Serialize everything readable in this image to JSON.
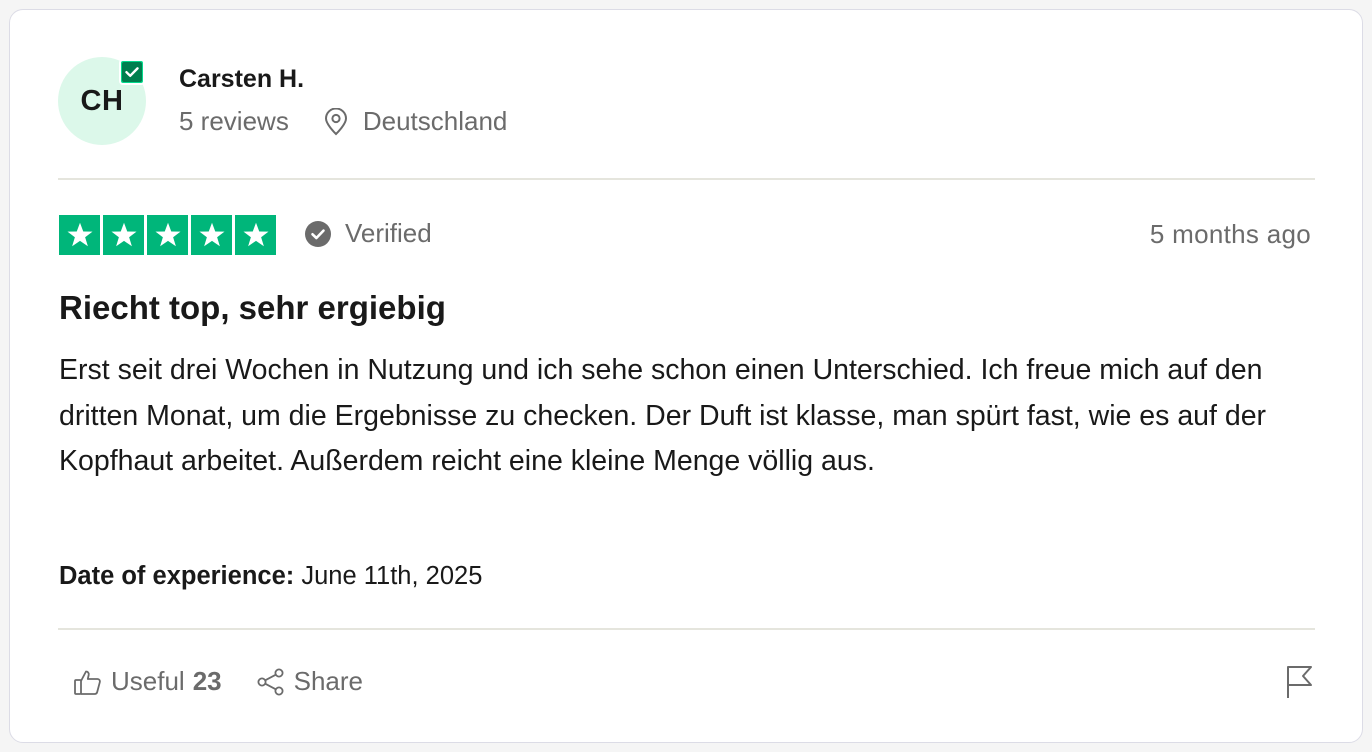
{
  "reviewer": {
    "initials": "CH",
    "name": "Carsten H.",
    "reviews_count": "5 reviews",
    "location": "Deutschland",
    "avatar_bg": "#dcf8ea",
    "badge_icon": "verified-check-badge-icon"
  },
  "review": {
    "rating": 5,
    "rating_max": 5,
    "star_color": "#00b67a",
    "verified_label": "Verified",
    "posted_ago": "5 months ago",
    "title": "Riecht top, sehr ergiebig",
    "body": "Erst seit drei Wochen in Nutzung und ich sehe schon einen Unterschied. Ich freue mich auf den dritten Monat, um die Ergebnisse zu checken. Der Duft ist klasse, man spürt fast, wie es auf der Kopfhaut arbeitet. Außerdem reicht eine kleine Menge völlig aus.",
    "experience_label": "Date of experience:",
    "experience_date": "June 11th, 2025"
  },
  "actions": {
    "useful_label": "Useful",
    "useful_count": "23",
    "share_label": "Share",
    "icons": [
      "thumbs-up-icon",
      "share-icon",
      "flag-icon"
    ]
  }
}
